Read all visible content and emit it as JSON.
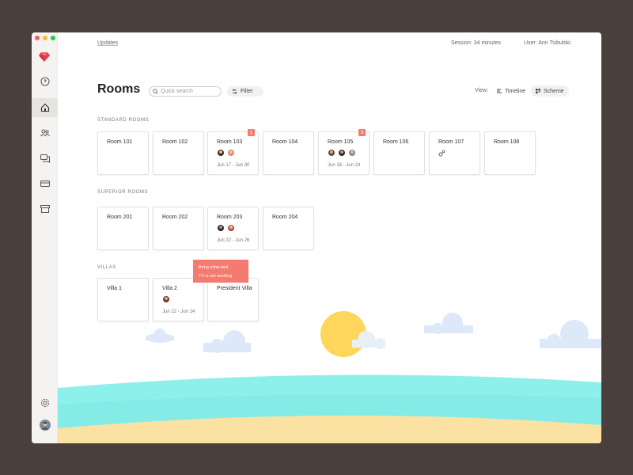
{
  "window": {
    "controls": [
      "close",
      "minimize",
      "maximize"
    ],
    "control_colors": [
      "#ff5f57",
      "#febc2e",
      "#28c840"
    ]
  },
  "sidebar": {
    "logo": "ruby-gem-icon",
    "items": [
      {
        "icon": "clock-icon",
        "active": false
      },
      {
        "icon": "home-icon",
        "active": true
      },
      {
        "icon": "users-icon",
        "active": false
      },
      {
        "icon": "chat-icon",
        "active": false
      },
      {
        "icon": "card-icon",
        "active": false
      },
      {
        "icon": "archive-icon",
        "active": false
      }
    ],
    "bottom": [
      "settings-icon",
      "user-avatar"
    ]
  },
  "topbar": {
    "updates": "Updates",
    "session": "Session: 34 minutes",
    "user": "User: Ann Tsibulski"
  },
  "header": {
    "title": "Rooms",
    "search_placeholder": "Quick search",
    "filter_label": "Filter",
    "view_label": "View:",
    "view_timeline": "Timeline",
    "view_scheme": "Scheme",
    "active_view": "Scheme"
  },
  "sections": [
    {
      "title": "STANDARD ROOMS",
      "rooms": [
        {
          "name": "Room 101"
        },
        {
          "name": "Room 102"
        },
        {
          "name": "Room 103",
          "badge": "1",
          "guests": 2,
          "dates": "Jun 17 - Jun 30"
        },
        {
          "name": "Room 104"
        },
        {
          "name": "Room 105",
          "badge": "3",
          "guests": 3,
          "dates": "Jun 18 - Jun 24"
        },
        {
          "name": "Room 106"
        },
        {
          "name": "Room 107",
          "status_icon": "maintenance-gears-icon"
        },
        {
          "name": "Room 108"
        }
      ]
    },
    {
      "title": "SUPERIOR ROOMS",
      "rooms": [
        {
          "name": "Room 201"
        },
        {
          "name": "Room 202"
        },
        {
          "name": "Room 203",
          "guests": 2,
          "dates": "Jun 22 - Jun 26"
        },
        {
          "name": "Room 204"
        }
      ]
    },
    {
      "title": "VILLAS",
      "rooms": [
        {
          "name": "Villa 1"
        },
        {
          "name": "Villa 2",
          "guests": 1,
          "dates": "Jun 22 - Jun 24"
        },
        {
          "name": "President Villa"
        }
      ]
    }
  ],
  "tooltip": {
    "lines": [
      "Bring extra bed",
      "TV is not working"
    ],
    "color": "#f47b6f"
  },
  "colors": {
    "accent_red": "#f47b6f",
    "sea": "#8ef0ea",
    "sand": "#fbe2a3",
    "sun": "#ffd65c",
    "cloud": "#dde9f8"
  }
}
